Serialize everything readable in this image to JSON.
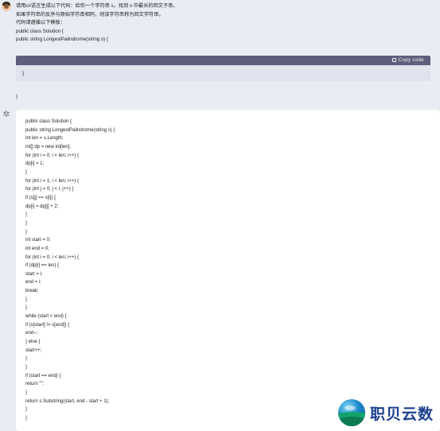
{
  "user_message": {
    "lines": [
      "请用c#语言生成以下代码：给你一个字符串 s，找到 s 中最长的回文子串。",
      "如果字符串的反序与原始字符串相同，则该字符串称为回文字符串。",
      "代码请遵循以下模板：",
      "public class Solution {",
      "public string LongestPalindrome(string s) {"
    ]
  },
  "code_block": {
    "copy_label": "Copy code",
    "content": "}"
  },
  "trailing_brace": "}",
  "answer": {
    "lines": [
      "public class Solution {",
      "public string LongestPalindrome(string s) {",
      "int len = s.Length;",
      "int[] dp = new int[len];",
      "for (int i = 0; i < len; i++) {",
      "dp[i] = 1;",
      "}",
      "for (int i = 1; i < len; i++) {",
      "for (int j = 0; j < i; j++) {",
      "if (s[j] == s[i]) {",
      "dp[i] = dp[j] + 2;",
      "}",
      "}",
      "}",
      "int start = 0;",
      "int end = 0;",
      "for (int i = 0; i < len; i++) {",
      "if (dp[i] == len) {",
      "start = i;",
      "end = i;",
      "break;",
      "}",
      "}",
      "while (start < end) {",
      "if (s[start] != s[end]) {",
      "end--;",
      "} else {",
      "start++;",
      "}",
      "}",
      "if (start == end) {",
      "return \"\";",
      "}",
      "return s.Substring(start, end - start + 1);",
      "}",
      "}"
    ]
  },
  "watermark_logo": {
    "text": "职贝云数"
  },
  "colors": {
    "code_bar": "#5e5f7b",
    "code_body": "#dfe3ee",
    "page_bg": "#e9ecf3",
    "logo_text": "#1b3f8f"
  }
}
